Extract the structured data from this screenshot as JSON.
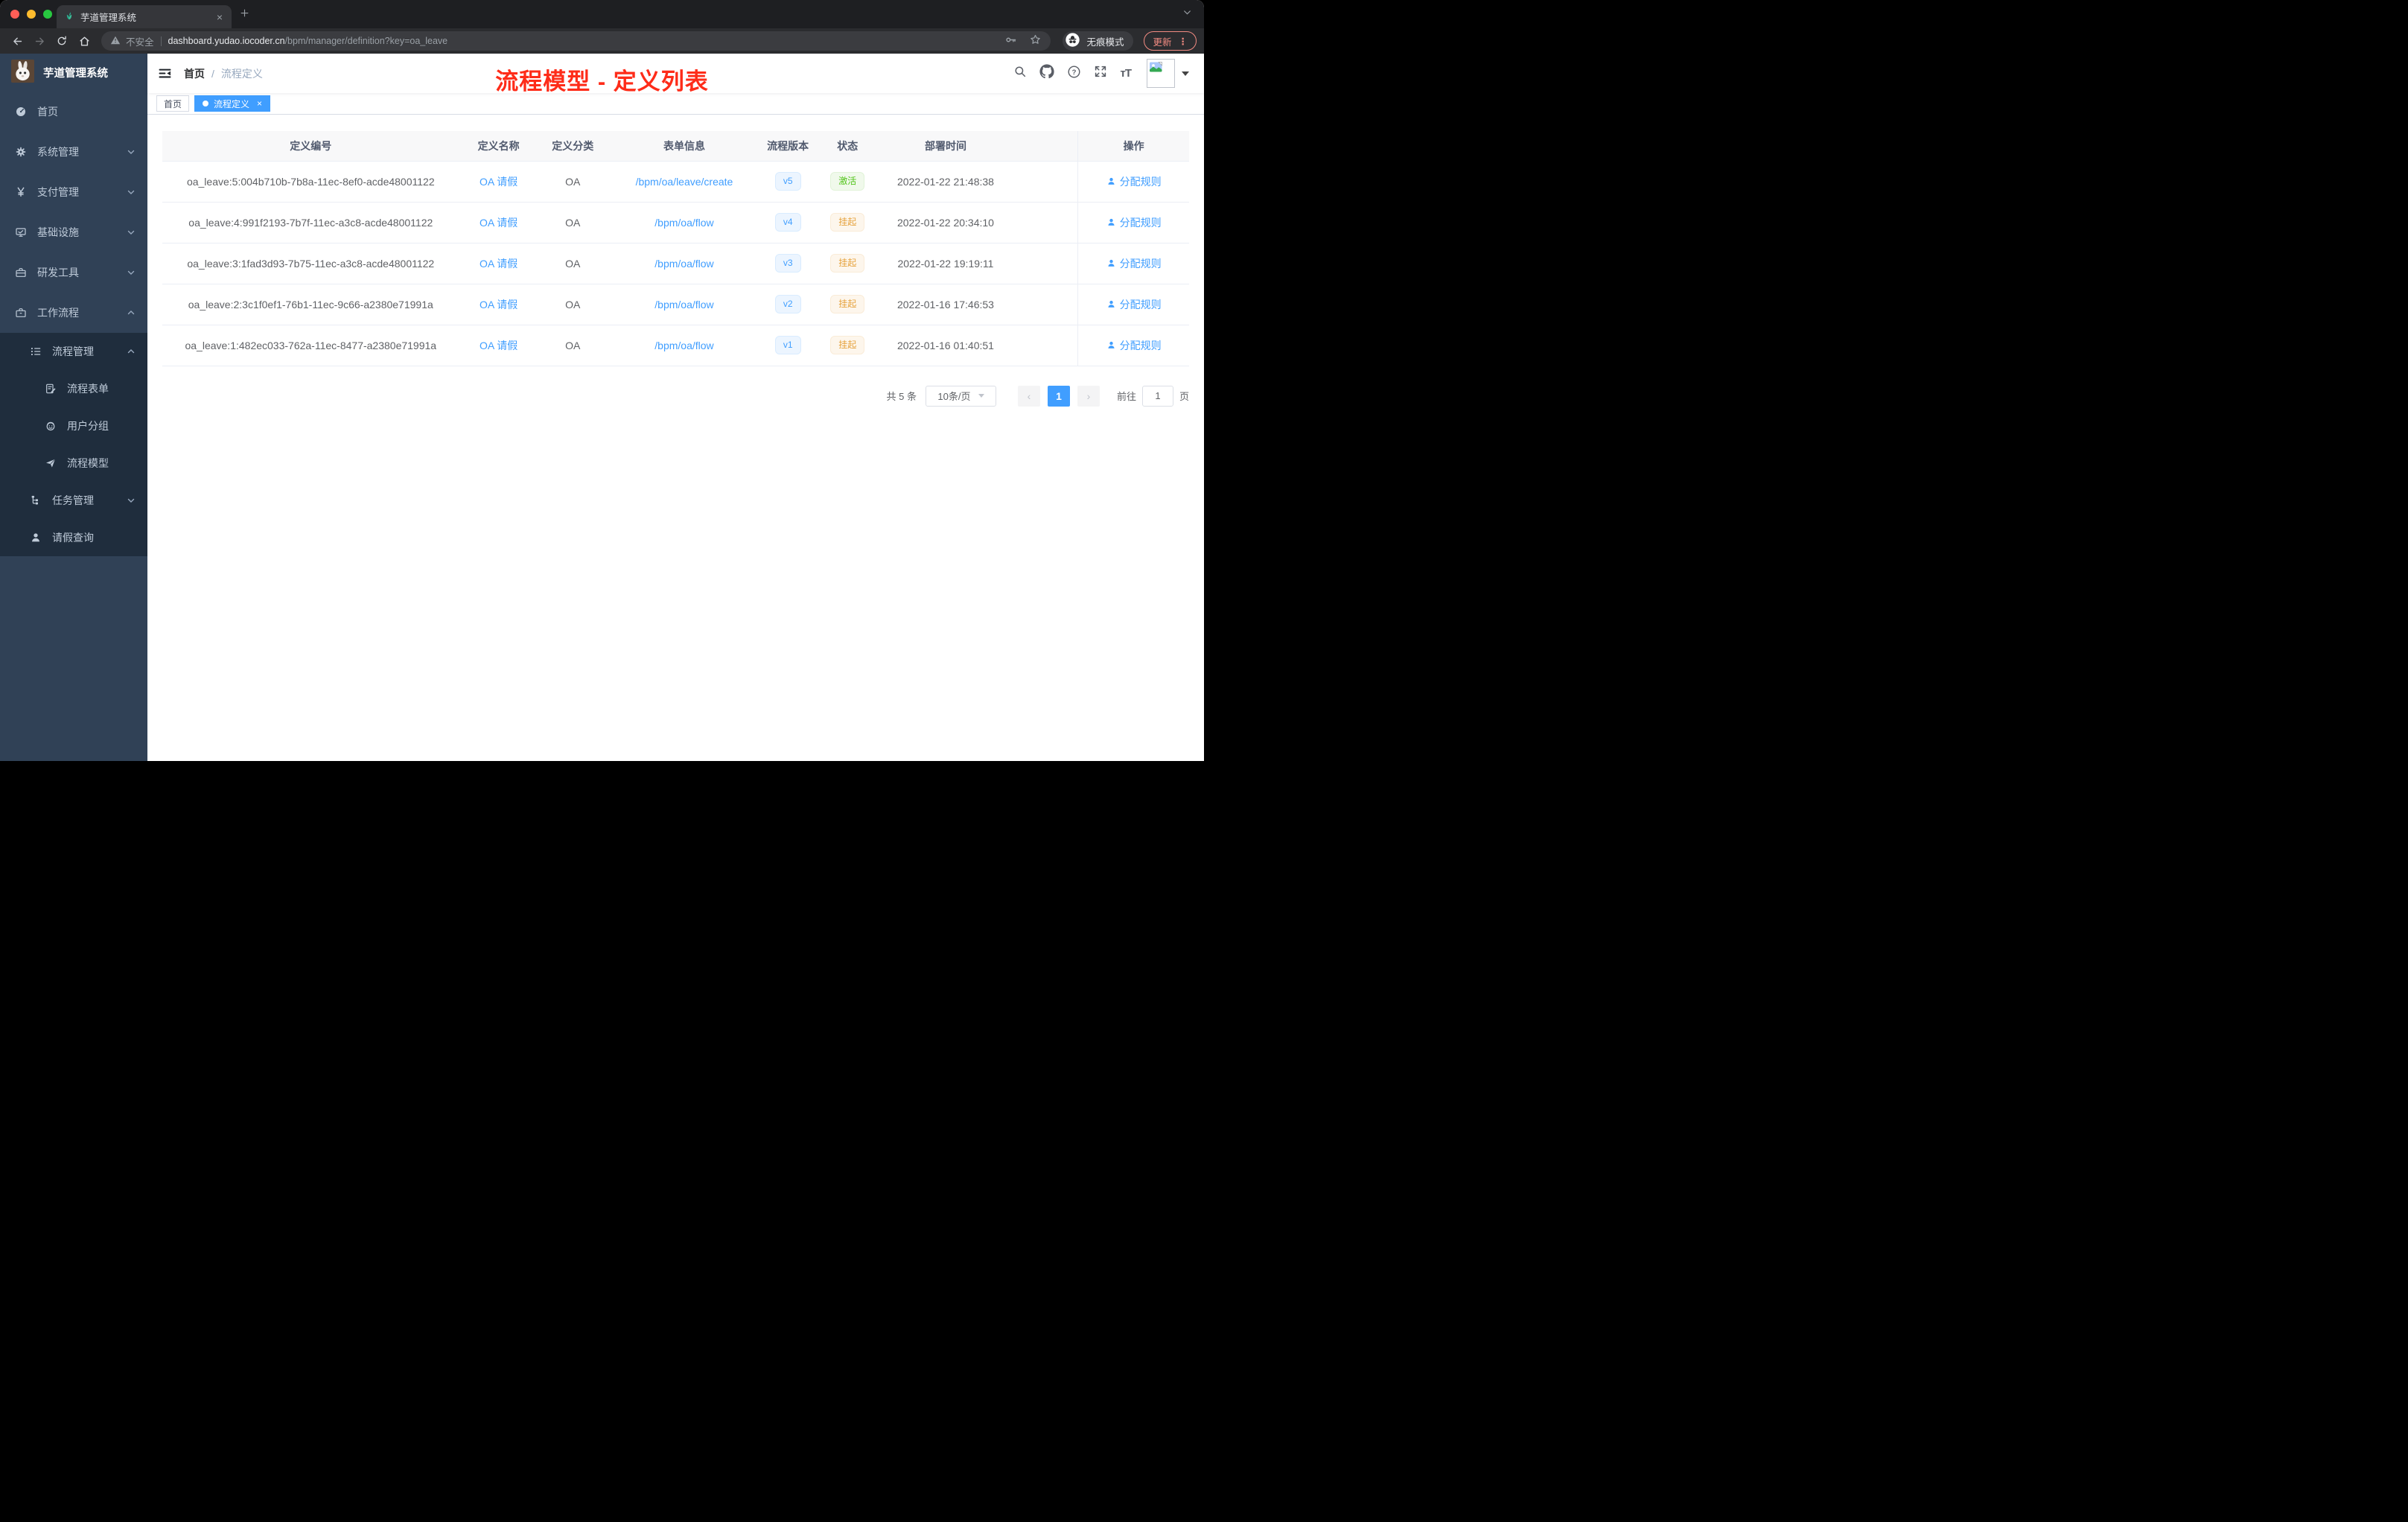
{
  "browser": {
    "tab": {
      "title": "芋道管理系统",
      "close_glyph": "×"
    },
    "new_tab_glyph": "+",
    "security_label": "不安全",
    "url_host": "dashboard.yudao.iocoder.cn",
    "url_path": "/bpm/manager/definition?key=oa_leave",
    "incognito_label": "无痕模式",
    "update_label": "更新",
    "menu_glyph": "⋮",
    "icons": [
      "back-icon",
      "forward-icon",
      "reload-icon",
      "home-icon",
      "warning-icon",
      "key-icon",
      "star-icon",
      "incognito-icon"
    ]
  },
  "sidebar": {
    "app_title": "芋道管理系统",
    "items": [
      {
        "label": "首页",
        "icon": "dashboard-icon",
        "chevron": "none"
      },
      {
        "label": "系统管理",
        "icon": "gear-icon",
        "chevron": "down"
      },
      {
        "label": "支付管理",
        "icon": "yen-icon",
        "chevron": "down"
      },
      {
        "label": "基础设施",
        "icon": "monitor-icon",
        "chevron": "down"
      },
      {
        "label": "研发工具",
        "icon": "toolbox-icon",
        "chevron": "down"
      },
      {
        "label": "工作流程",
        "icon": "briefcase-icon",
        "chevron": "up"
      }
    ],
    "submenu": [
      {
        "label": "流程管理",
        "icon": "list-icon",
        "chevron": "up"
      },
      {
        "label": "流程表单",
        "icon": "form-icon",
        "chevron": "none"
      },
      {
        "label": "用户分组",
        "icon": "group-icon",
        "chevron": "none"
      },
      {
        "label": "流程模型",
        "icon": "paper-plane-icon",
        "chevron": "none"
      },
      {
        "label": "任务管理",
        "icon": "tree-icon",
        "chevron": "down"
      },
      {
        "label": "请假查询",
        "icon": "user-icon",
        "chevron": "none"
      }
    ]
  },
  "header": {
    "breadcrumb": [
      "首页",
      "流程定义"
    ],
    "breadcrumb_separator": "/",
    "annotation": "流程模型 - 定义列表",
    "annotation_color": "#fe2c19",
    "icons": [
      "search-icon",
      "github-icon",
      "help-icon",
      "fullscreen-icon",
      "fontsize-icon",
      "avatar",
      "caret-down-icon"
    ]
  },
  "tags_view": {
    "tabs": [
      {
        "label": "首页",
        "active": false
      },
      {
        "label": "流程定义",
        "active": true,
        "close_glyph": "×"
      }
    ]
  },
  "table": {
    "columns": [
      "定义编号",
      "定义名称",
      "定义分类",
      "表单信息",
      "流程版本",
      "状态",
      "部署时间",
      "操作"
    ],
    "rows": [
      {
        "id": "oa_leave:5:004b710b-7b8a-11ec-8ef0-acde48001122",
        "name": "OA 请假",
        "category": "OA",
        "form": "/bpm/oa/leave/create",
        "version": "v5",
        "status": "激活",
        "time": "2022-01-22 21:48:38",
        "action": "分配规则"
      },
      {
        "id": "oa_leave:4:991f2193-7b7f-11ec-a3c8-acde48001122",
        "name": "OA 请假",
        "category": "OA",
        "form": "/bpm/oa/flow",
        "version": "v4",
        "status": "挂起",
        "time": "2022-01-22 20:34:10",
        "action": "分配规则"
      },
      {
        "id": "oa_leave:3:1fad3d93-7b75-11ec-a3c8-acde48001122",
        "name": "OA 请假",
        "category": "OA",
        "form": "/bpm/oa/flow",
        "version": "v3",
        "status": "挂起",
        "time": "2022-01-22 19:19:11",
        "action": "分配规则"
      },
      {
        "id": "oa_leave:2:3c1f0ef1-76b1-11ec-9c66-a2380e71991a",
        "name": "OA 请假",
        "category": "OA",
        "form": "/bpm/oa/flow",
        "version": "v2",
        "status": "挂起",
        "time": "2022-01-16 17:46:53",
        "action": "分配规则"
      },
      {
        "id": "oa_leave:1:482ec033-762a-11ec-8477-a2380e71991a",
        "name": "OA 请假",
        "category": "OA",
        "form": "/bpm/oa/flow",
        "version": "v1",
        "status": "挂起",
        "time": "2022-01-16 01:40:51",
        "action": "分配规则"
      }
    ]
  },
  "pagination": {
    "total": "共 5 条",
    "page_size": "10条/页",
    "prev_glyph": "‹",
    "next_glyph": "›",
    "current_page": "1",
    "goto_label": "前往",
    "goto_value": "1",
    "unit_label": "页"
  },
  "colors": {
    "accent": "#409eff",
    "success": "#52c41a",
    "warning": "#e6a23c",
    "sidebar_bg": "#304156",
    "submenu_bg": "#1f2d3d",
    "annotation_red": "#fe2c19"
  }
}
